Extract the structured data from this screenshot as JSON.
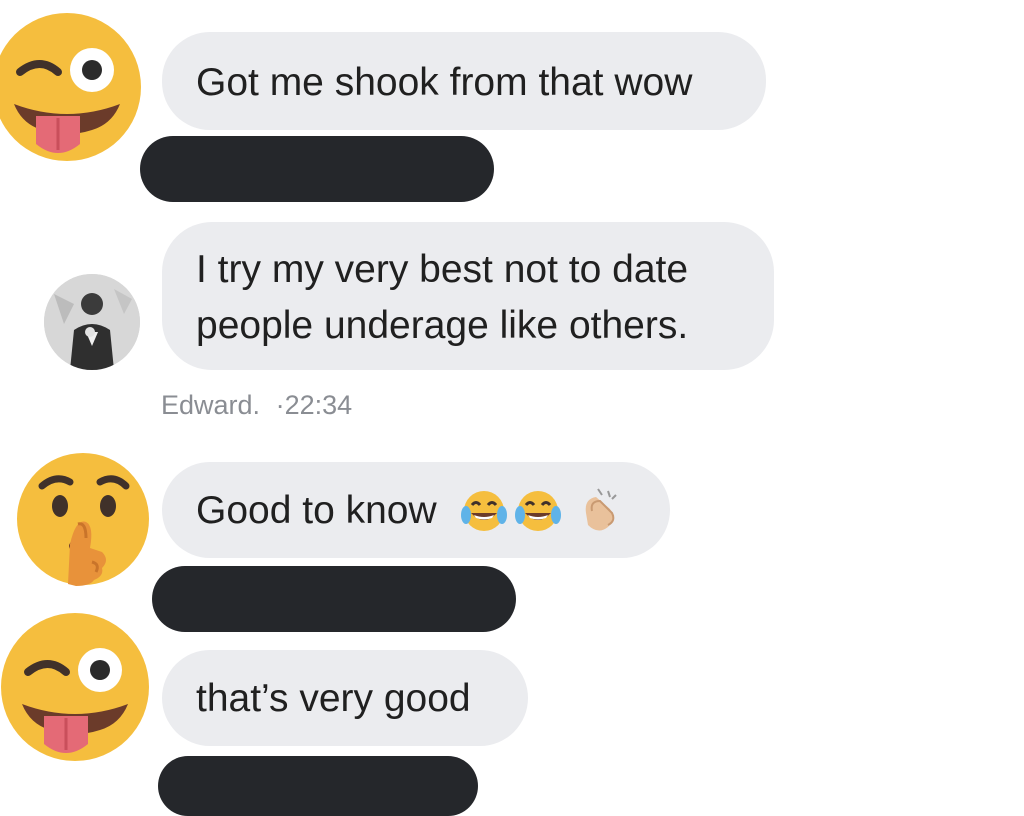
{
  "messages": [
    {
      "sender_avatar": "winking-tongue-emoji",
      "text": "Got me shook from that wow"
    },
    {
      "sender_avatar": "user-photo",
      "line1": "I try my very best not to date",
      "line2": "people underage like others."
    },
    {
      "sender_avatar": "shushing-face-emoji",
      "text": "Good to know",
      "emojis": [
        "face-with-tears-of-joy",
        "face-with-tears-of-joy",
        "clapping-hands"
      ]
    },
    {
      "sender_avatar": "winking-tongue-emoji",
      "text": "that’s very good"
    }
  ],
  "meta": {
    "sender": "Edward.",
    "separator": "·",
    "time": "22:34"
  },
  "colors": {
    "bubble": "#ebecef",
    "redaction": "#25272b",
    "emoji_yellow": "#f5be3e",
    "meta_text": "#8a8d93"
  }
}
